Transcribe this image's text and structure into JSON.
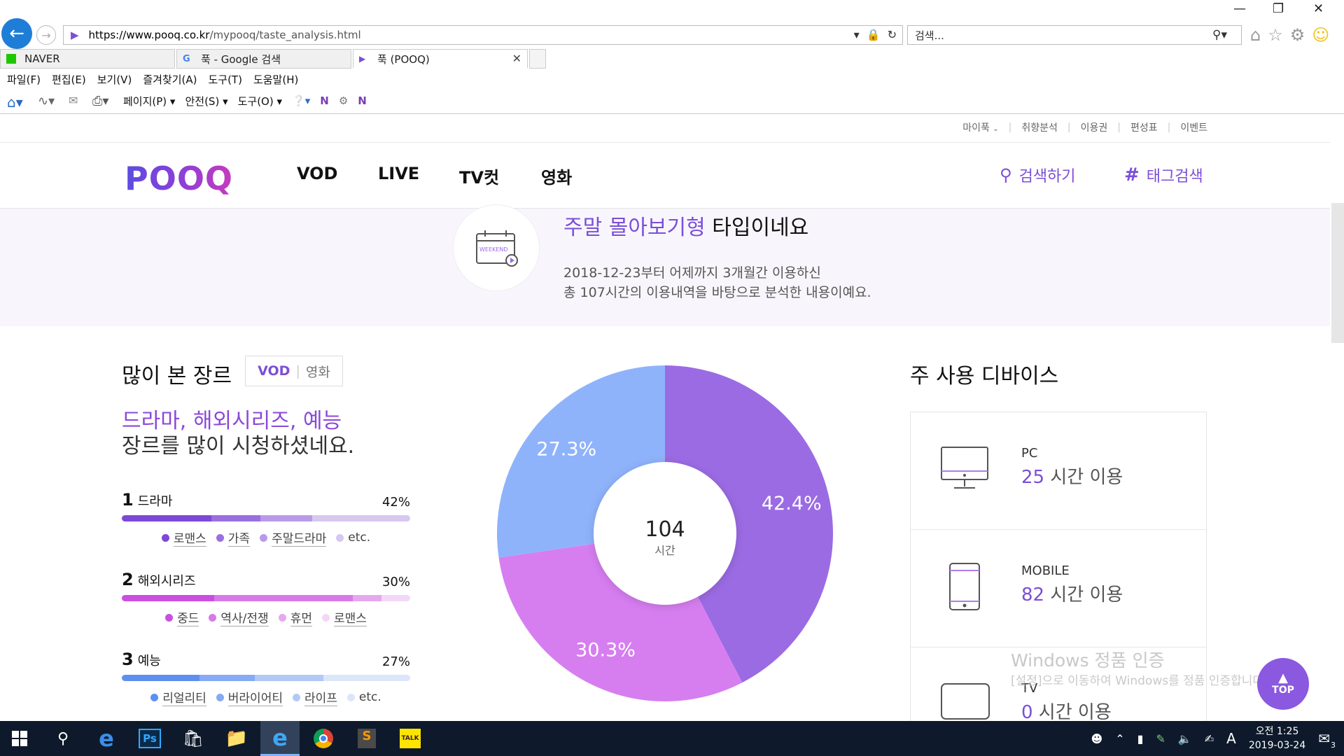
{
  "browser": {
    "url_domain": "https://www.pooq.co.kr",
    "url_path": "/mypooq/taste_analysis.html",
    "search_placeholder": "검색...",
    "tabs": [
      {
        "label": "NAVER"
      },
      {
        "label": "푹 - Google 검색"
      },
      {
        "label": "푹 (POOQ)"
      }
    ],
    "menu": [
      "파일(F)",
      "편집(E)",
      "보기(V)",
      "즐겨찾기(A)",
      "도구(T)",
      "도움말(H)"
    ],
    "cmd": [
      "페이지(P)",
      "안전(S)",
      "도구(O)"
    ]
  },
  "site": {
    "util_nav": [
      "마이푹",
      "취향분석",
      "이용권",
      "편성표",
      "이벤트"
    ],
    "logo": "POOQ",
    "gnb": [
      "VOD",
      "LIVE",
      "TV컷",
      "영화"
    ],
    "search_label": "검색하기",
    "tag_search_label": "태그검색"
  },
  "type": {
    "highlight": "주말 몰아보기형",
    "suffix": " 타입이네요",
    "desc_line1": "2018-12-23부터 어제까지 3개월간 이용하신",
    "desc_line2": "총 107시간의 이용내역을 바탕으로 분석한 내용이예요.",
    "icon_text": "WEEKEND"
  },
  "genre": {
    "title": "많이 본 장르",
    "toggle_vod": "VOD",
    "toggle_movie": "영화",
    "headline_highlight": "드라마, 해외시리즈, 예능",
    "headline_rest": "장르를 많이 시청하셨네요.",
    "ranks": [
      {
        "num": "1",
        "name": "드라마",
        "pct": "42%",
        "segments": [
          {
            "color": "#7d48d8",
            "w": 0.31
          },
          {
            "color": "#9a6fe0",
            "w": 0.17
          },
          {
            "color": "#b99ae8",
            "w": 0.18
          },
          {
            "color": "#d7c8ef",
            "w": 0.34
          }
        ],
        "legend": [
          {
            "label": "로맨스",
            "color": "#7d48d8"
          },
          {
            "label": "가족",
            "color": "#9a6fe0"
          },
          {
            "label": "주말드라마",
            "color": "#b99ae8"
          },
          {
            "label": "etc.",
            "color": "#d7c8ef"
          }
        ]
      },
      {
        "num": "2",
        "name": "해외시리즈",
        "pct": "30%",
        "segments": [
          {
            "color": "#c94fe0",
            "w": 0.32
          },
          {
            "color": "#d77ae8",
            "w": 0.48
          },
          {
            "color": "#e5a8ef",
            "w": 0.1
          },
          {
            "color": "#f2d8f6",
            "w": 0.1
          }
        ],
        "legend": [
          {
            "label": "중드",
            "color": "#c94fe0"
          },
          {
            "label": "역사/전쟁",
            "color": "#d77ae8"
          },
          {
            "label": "휴먼",
            "color": "#e5a8ef"
          },
          {
            "label": "로맨스",
            "color": "#f2d8f6"
          }
        ]
      },
      {
        "num": "3",
        "name": "예능",
        "pct": "27%",
        "segments": [
          {
            "color": "#5e8ff0",
            "w": 0.27
          },
          {
            "color": "#86aaf3",
            "w": 0.19
          },
          {
            "color": "#b2c8f7",
            "w": 0.24
          },
          {
            "color": "#dbe6fb",
            "w": 0.3
          }
        ],
        "legend": [
          {
            "label": "리얼리티",
            "color": "#5e8ff0"
          },
          {
            "label": "버라이어티",
            "color": "#86aaf3"
          },
          {
            "label": "라이프",
            "color": "#b2c8f7"
          },
          {
            "label": "etc.",
            "color": "#dbe6fb"
          }
        ]
      }
    ]
  },
  "chart_data": {
    "type": "pie",
    "categories": [
      "드라마",
      "해외시리즈",
      "예능"
    ],
    "values": [
      42.4,
      30.3,
      27.3
    ],
    "labels": [
      "42.4%",
      "30.3%",
      "27.3%"
    ],
    "colors": [
      "#9b6be3",
      "#d67ef0",
      "#8fb3fb"
    ],
    "center_value": "104",
    "center_unit": "시간"
  },
  "device": {
    "title": "주 사용 디바이스",
    "rows": [
      {
        "name": "PC",
        "hours": "25",
        "unit": " 시간 이용"
      },
      {
        "name": "MOBILE",
        "hours": "82",
        "unit": " 시간 이용"
      },
      {
        "name": "TV",
        "hours": "0",
        "unit": " 시간 이용"
      }
    ]
  },
  "watermark": {
    "line1": "Windows 정품 인증",
    "line2": "[설정]으로 이동하여 Windows를 정품 인증합니다."
  },
  "top_button": "TOP",
  "taskbar": {
    "clock_time": "오전 1:25",
    "clock_date": "2019-03-24",
    "ime": "A",
    "notif_count": "3"
  }
}
